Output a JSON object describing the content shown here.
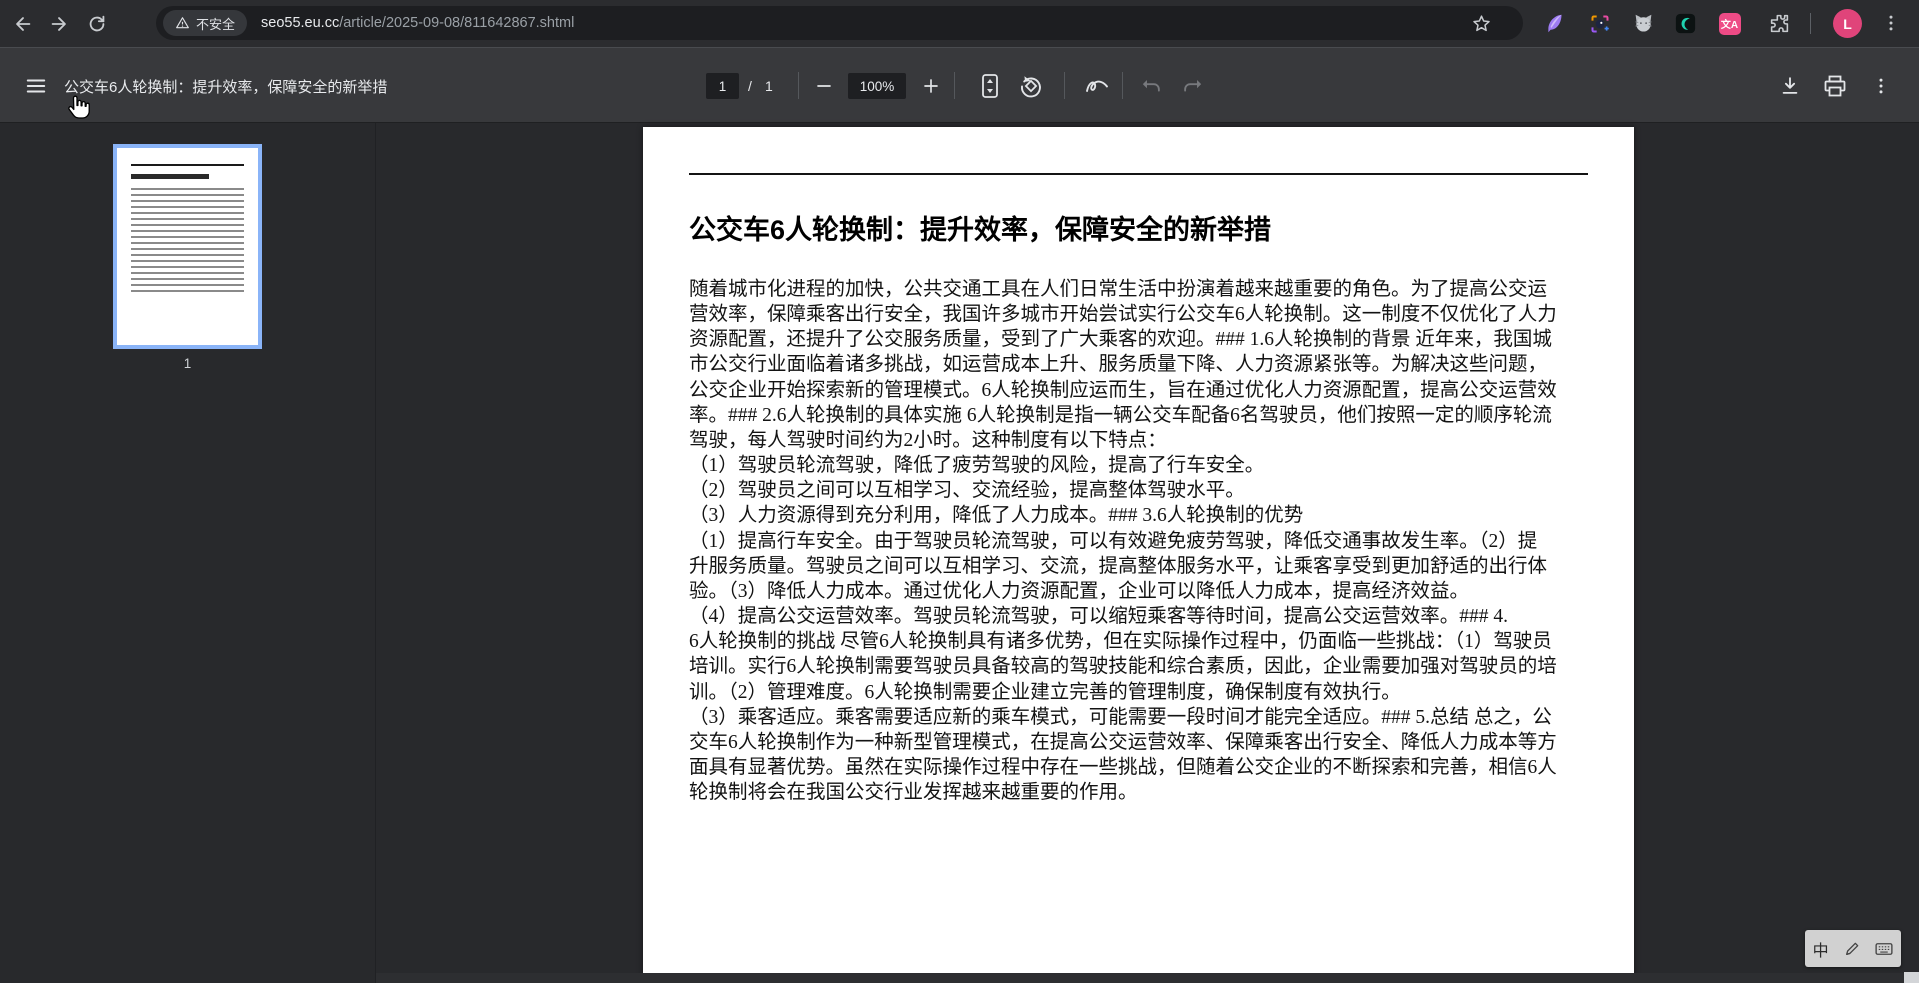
{
  "browser": {
    "security_label": "不安全",
    "url_domain": "seo55.eu.cc",
    "url_path": "/article/2025-09-08/811642867.shtml",
    "profile_initial": "L",
    "translate_extension_badge": "文A"
  },
  "pdf_toolbar": {
    "title": "公交车6人轮换制：提升效率，保障安全的新举措",
    "page_current": "1",
    "page_separator": "/",
    "page_total": "1",
    "zoom_level": "100%"
  },
  "sidebar": {
    "page_label": "1"
  },
  "document": {
    "title": "公交车6人轮换制：提升效率，保障安全的新举措",
    "body_lines": [
      "随着城市化进程的加快，公共交通工具在人们日常生活中扮演着越来越重要的角色。为了提高公交运",
      "营效率，保障乘客出行安全，我国许多城市开始尝试实行公交车6人轮换制。这一制度不仅优化了人力",
      "资源配置，还提升了公交服务质量，受到了广大乘客的欢迎。### 1.6人轮换制的背景 近年来，我国城",
      "市公交行业面临着诸多挑战，如运营成本上升、服务质量下降、人力资源紧张等。为解决这些问题，",
      "公交企业开始探索新的管理模式。6人轮换制应运而生，旨在通过优化人力资源配置，提高公交运营效",
      "率。### 2.6人轮换制的具体实施 6人轮换制是指一辆公交车配备6名驾驶员，他们按照一定的顺序轮流",
      "驾驶，每人驾驶时间约为2小时。这种制度有以下特点：",
      "（1）驾驶员轮流驾驶，降低了疲劳驾驶的风险，提高了行车安全。",
      "（2）驾驶员之间可以互相学习、交流经验，提高整体驾驶水平。",
      "（3）人力资源得到充分利用，降低了人力成本。### 3.6人轮换制的优势",
      "（1）提高行车安全。由于驾驶员轮流驾驶，可以有效避免疲劳驾驶，降低交通事故发生率。（2）提",
      "升服务质量。驾驶员之间可以互相学习、交流，提高整体服务水平，让乘客享受到更加舒适的出行体",
      "验。（3）降低人力成本。通过优化人力资源配置，企业可以降低人力成本，提高经济效益。",
      "（4）提高公交运营效率。驾驶员轮流驾驶，可以缩短乘客等待时间，提高公交运营效率。### 4.",
      "6人轮换制的挑战 尽管6人轮换制具有诸多优势，但在实际操作过程中，仍面临一些挑战：（1）驾驶员",
      "培训。实行6人轮换制需要驾驶员具备较高的驾驶技能和综合素质，因此，企业需要加强对驾驶员的培",
      "训。（2）管理难度。6人轮换制需要企业建立完善的管理制度，确保制度有效执行。",
      "（3）乘客适应。乘客需要适应新的乘车模式，可能需要一段时间才能完全适应。### 5.总结 总之，公",
      "交车6人轮换制作为一种新型管理模式，在提高公交运营效率、保障乘客出行安全、降低人力成本等方",
      "面具有显著优势。虽然在实际操作过程中存在一些挑战，但随着公交企业的不断探索和完善，相信6人",
      "轮换制将会在我国公交行业发挥越来越重要的作用。"
    ]
  },
  "ime": {
    "mode_label": "中"
  }
}
